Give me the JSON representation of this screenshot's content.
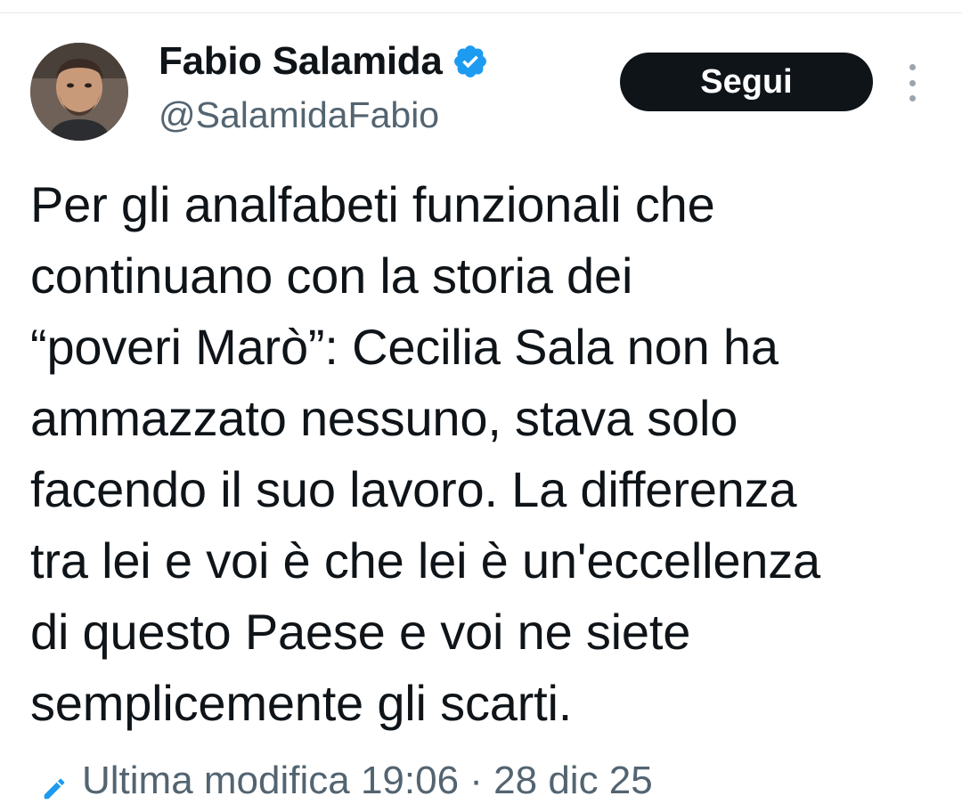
{
  "tweet": {
    "author": {
      "display_name": "Fabio Salamida",
      "handle": "@SalamidaFabio",
      "verified": true
    },
    "follow_label": "Segui",
    "text": "Per gli analfabeti funzionali che\ncontinuano con la storia dei\n“poveri Marò”: Cecilia Sala non ha\nammazzato nessuno, stava solo\nfacendo il suo lavoro. La differenza\ntra lei e voi è che lei è un'eccellenza\ndi questo Paese e voi ne siete\nsemplicemente gli scarti.",
    "edit_note": "Ultima modifica 19:06 · 28 dic 25"
  },
  "icons": {
    "verified": "verified-badge-icon",
    "more": "more-vertical-icon",
    "edit": "pencil-icon"
  },
  "colors": {
    "verified_blue": "#1d9bf0",
    "follow_button_bg": "#0f1419",
    "secondary_text": "#536471"
  }
}
